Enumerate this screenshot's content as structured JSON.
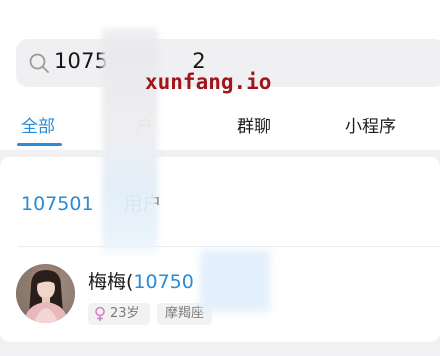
{
  "search": {
    "query": "1075",
    "query_tail": "2",
    "icon": "search-icon"
  },
  "watermark": "xunfang.io",
  "tabs": [
    {
      "label": "全部",
      "active": true
    },
    {
      "label": "户",
      "active": false
    },
    {
      "label": "群聊",
      "active": false
    },
    {
      "label": "小程序",
      "active": false
    }
  ],
  "results": {
    "phone_row": {
      "number": "107501",
      "suffix": "用户"
    },
    "user": {
      "name": "梅梅(",
      "number": "10750",
      "age": "23岁",
      "zodiac": "摩羯座",
      "gender_icon": "female-icon"
    }
  },
  "colors": {
    "accent": "#2a8bd6",
    "female": "#d87fc5",
    "background": "#f1f1f3"
  }
}
